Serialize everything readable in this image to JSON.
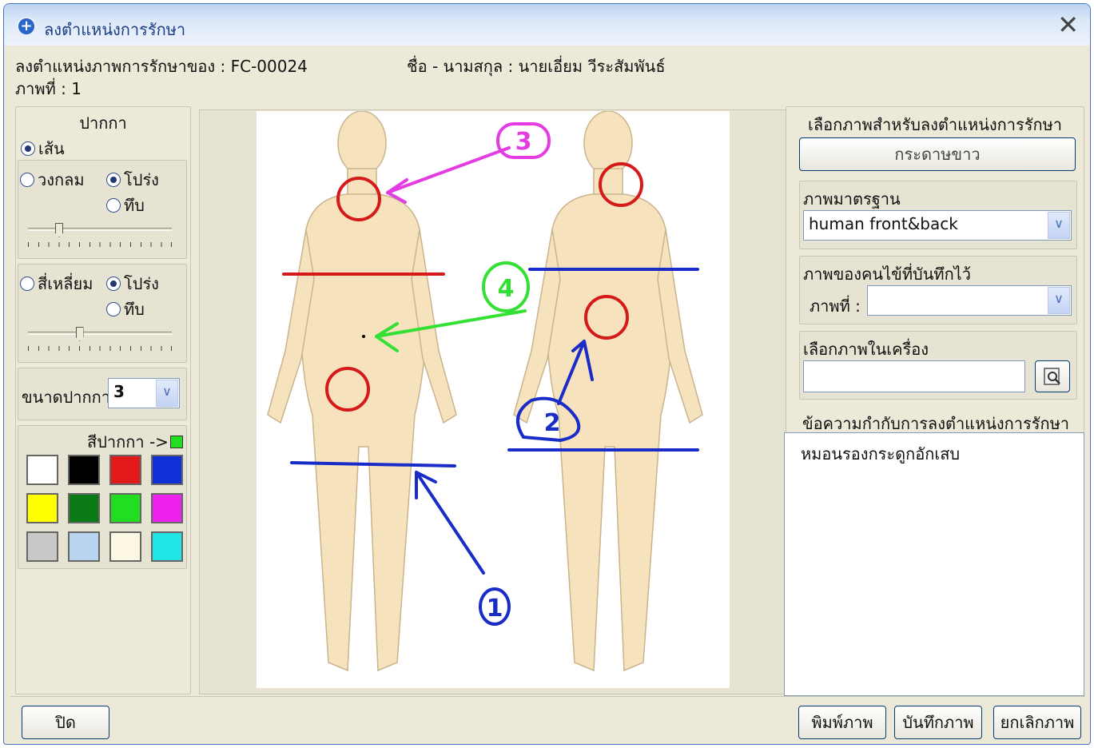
{
  "window": {
    "title": "ลงตำแหน่งการรักษา",
    "close_glyph": "✕",
    "icon": "medical-plus-icon",
    "icon_glyph": "+"
  },
  "header": {
    "record_label": "ลงตำแหน่งภาพการรักษาของ : FC-00024",
    "patient_label": "ชื่อ - นามสกุล : นายเอี่ยม วีระสัมพันธ์",
    "image_label": "ภาพที่ : 1"
  },
  "pen": {
    "title": "ปากกา",
    "line_label": "เส้น",
    "circle_label": "วงกลม",
    "circle_transparent": "โปร่ง",
    "circle_solid": "ทึบ",
    "square_label": "สี่เหลี่ยม",
    "square_transparent": "โปร่ง",
    "square_solid": "ทึบ",
    "circle_slider_level": 0.2,
    "square_slider_level": 0.35,
    "size_label": "ขนาดปากกา",
    "size_value": "3",
    "color_label": "สีปากกา ->",
    "current_color": "#22dd22",
    "palette": [
      "#ffffff",
      "#000000",
      "#e21a1a",
      "#1030d8",
      "#ffff00",
      "#0b7a14",
      "#22dd22",
      "#ee22ee",
      "#c8c8c8",
      "#b8d4ee",
      "#fdf8e4",
      "#22e6e6"
    ]
  },
  "annotation_colors": {
    "skin": "#f6e3bd",
    "red": "#d51a1a",
    "blue": "#1a2cc8",
    "green": "#33e033",
    "magenta": "#e23ce2"
  },
  "annotation_numbers": [
    "3",
    "4",
    "2",
    "1"
  ],
  "right": {
    "select_title": "เลือกภาพสำหรับลงตำแหน่งการรักษา",
    "blank_paper_button": "กระดาษขาว",
    "standard_label": "ภาพมาตรฐาน",
    "standard_value": "human front&back",
    "saved_label": "ภาพของคนไข้ที่บันทึกไว้",
    "saved_image_label": "ภาพที่ :",
    "saved_image_value": "",
    "local_label": "เลือกภาพในเครื่อง",
    "local_path": "",
    "note_label": "ข้อความกำกับการลงตำแหน่งการรักษา",
    "note_text": "หมอนรองกระดูกอักเสบ"
  },
  "footer": {
    "close_button": "ปิด",
    "print_button": "พิมพ์ภาพ",
    "save_button": "บันทึกภาพ",
    "cancel_button": "ยกเลิกภาพ"
  }
}
